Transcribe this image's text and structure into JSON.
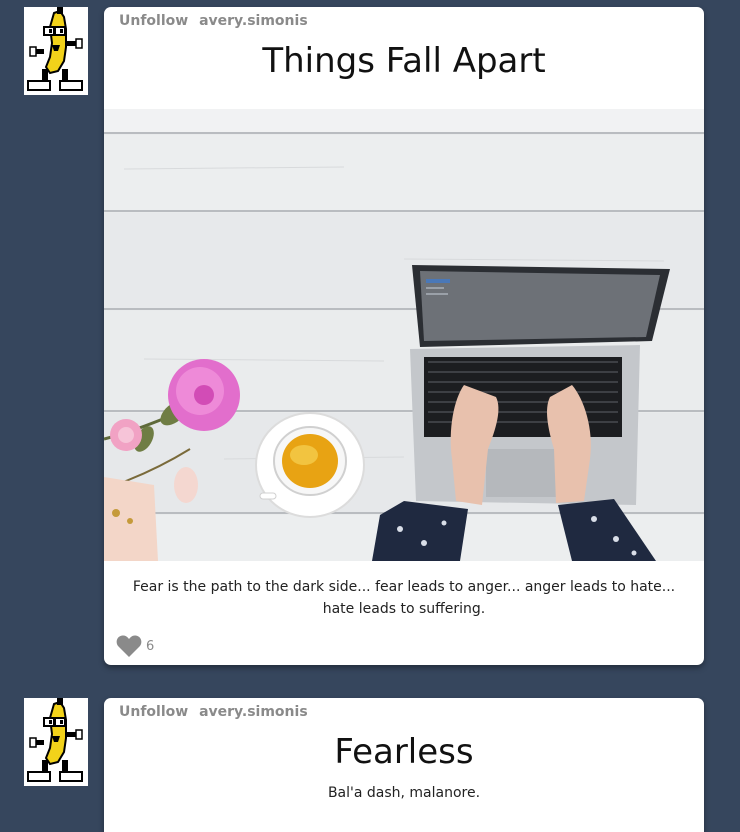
{
  "posts": [
    {
      "unfollow_label": "Unfollow",
      "username": "avery.simonis",
      "title": "Things Fall Apart",
      "body": "Fear is the path to the dark side... fear leads to anger... anger leads to hate... hate leads to suffering.",
      "like_count": "6",
      "avatar_icon": "dancing-banana-icon",
      "like_icon": "heart-icon"
    },
    {
      "unfollow_label": "Unfollow",
      "username": "avery.simonis",
      "title": "Fearless",
      "body": "Bal'a dash, malanore.",
      "avatar_icon": "dancing-banana-icon"
    }
  ],
  "colors": {
    "page_background": "#36465d",
    "card_background": "#ffffff",
    "muted_text": "#8a8a8a",
    "heart": "#8a8a8a"
  }
}
